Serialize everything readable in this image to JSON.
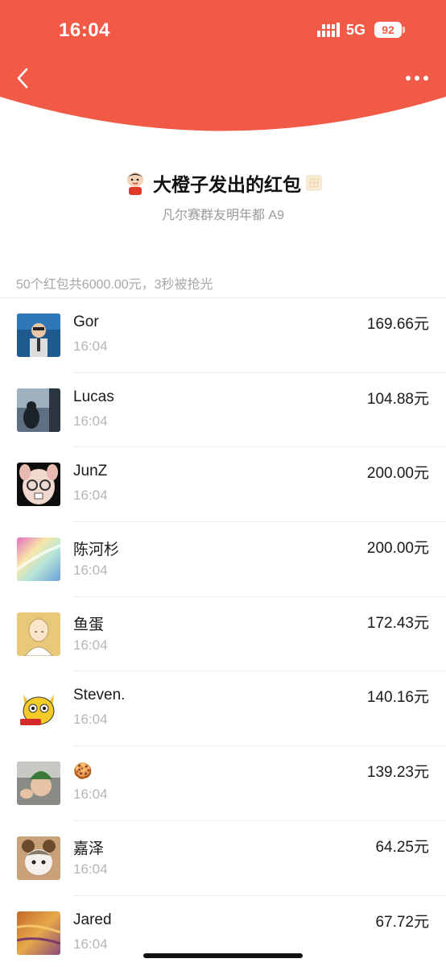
{
  "status_bar": {
    "time": "16:04",
    "network": "5G",
    "battery": "92"
  },
  "colors": {
    "header_red": "#F05A47",
    "secondary_text": "#9a9a9a"
  },
  "header": {
    "back_icon": "chevron-left-icon",
    "more_icon": "more-dots-icon"
  },
  "sender": {
    "title": "大橙子发出的红包",
    "group": "凡尔赛群友明年都 A9"
  },
  "summary": "50个红包共6000.00元，3秒被抢光",
  "records": [
    {
      "name": "Gor",
      "time": "16:04",
      "amount": "169.66元"
    },
    {
      "name": "Lucas",
      "time": "16:04",
      "amount": "104.88元"
    },
    {
      "name": "JunZ",
      "time": "16:04",
      "amount": "200.00元"
    },
    {
      "name": "陈河杉",
      "time": "16:04",
      "amount": "200.00元"
    },
    {
      "name": "鱼蛋",
      "time": "16:04",
      "amount": "172.43元"
    },
    {
      "name": "Steven.",
      "time": "16:04",
      "amount": "140.16元"
    },
    {
      "name": "🍪",
      "time": "16:04",
      "amount": "139.23元"
    },
    {
      "name": "嘉泽",
      "time": "16:04",
      "amount": "64.25元"
    },
    {
      "name": "Jared",
      "time": "16:04",
      "amount": "67.72元"
    }
  ]
}
